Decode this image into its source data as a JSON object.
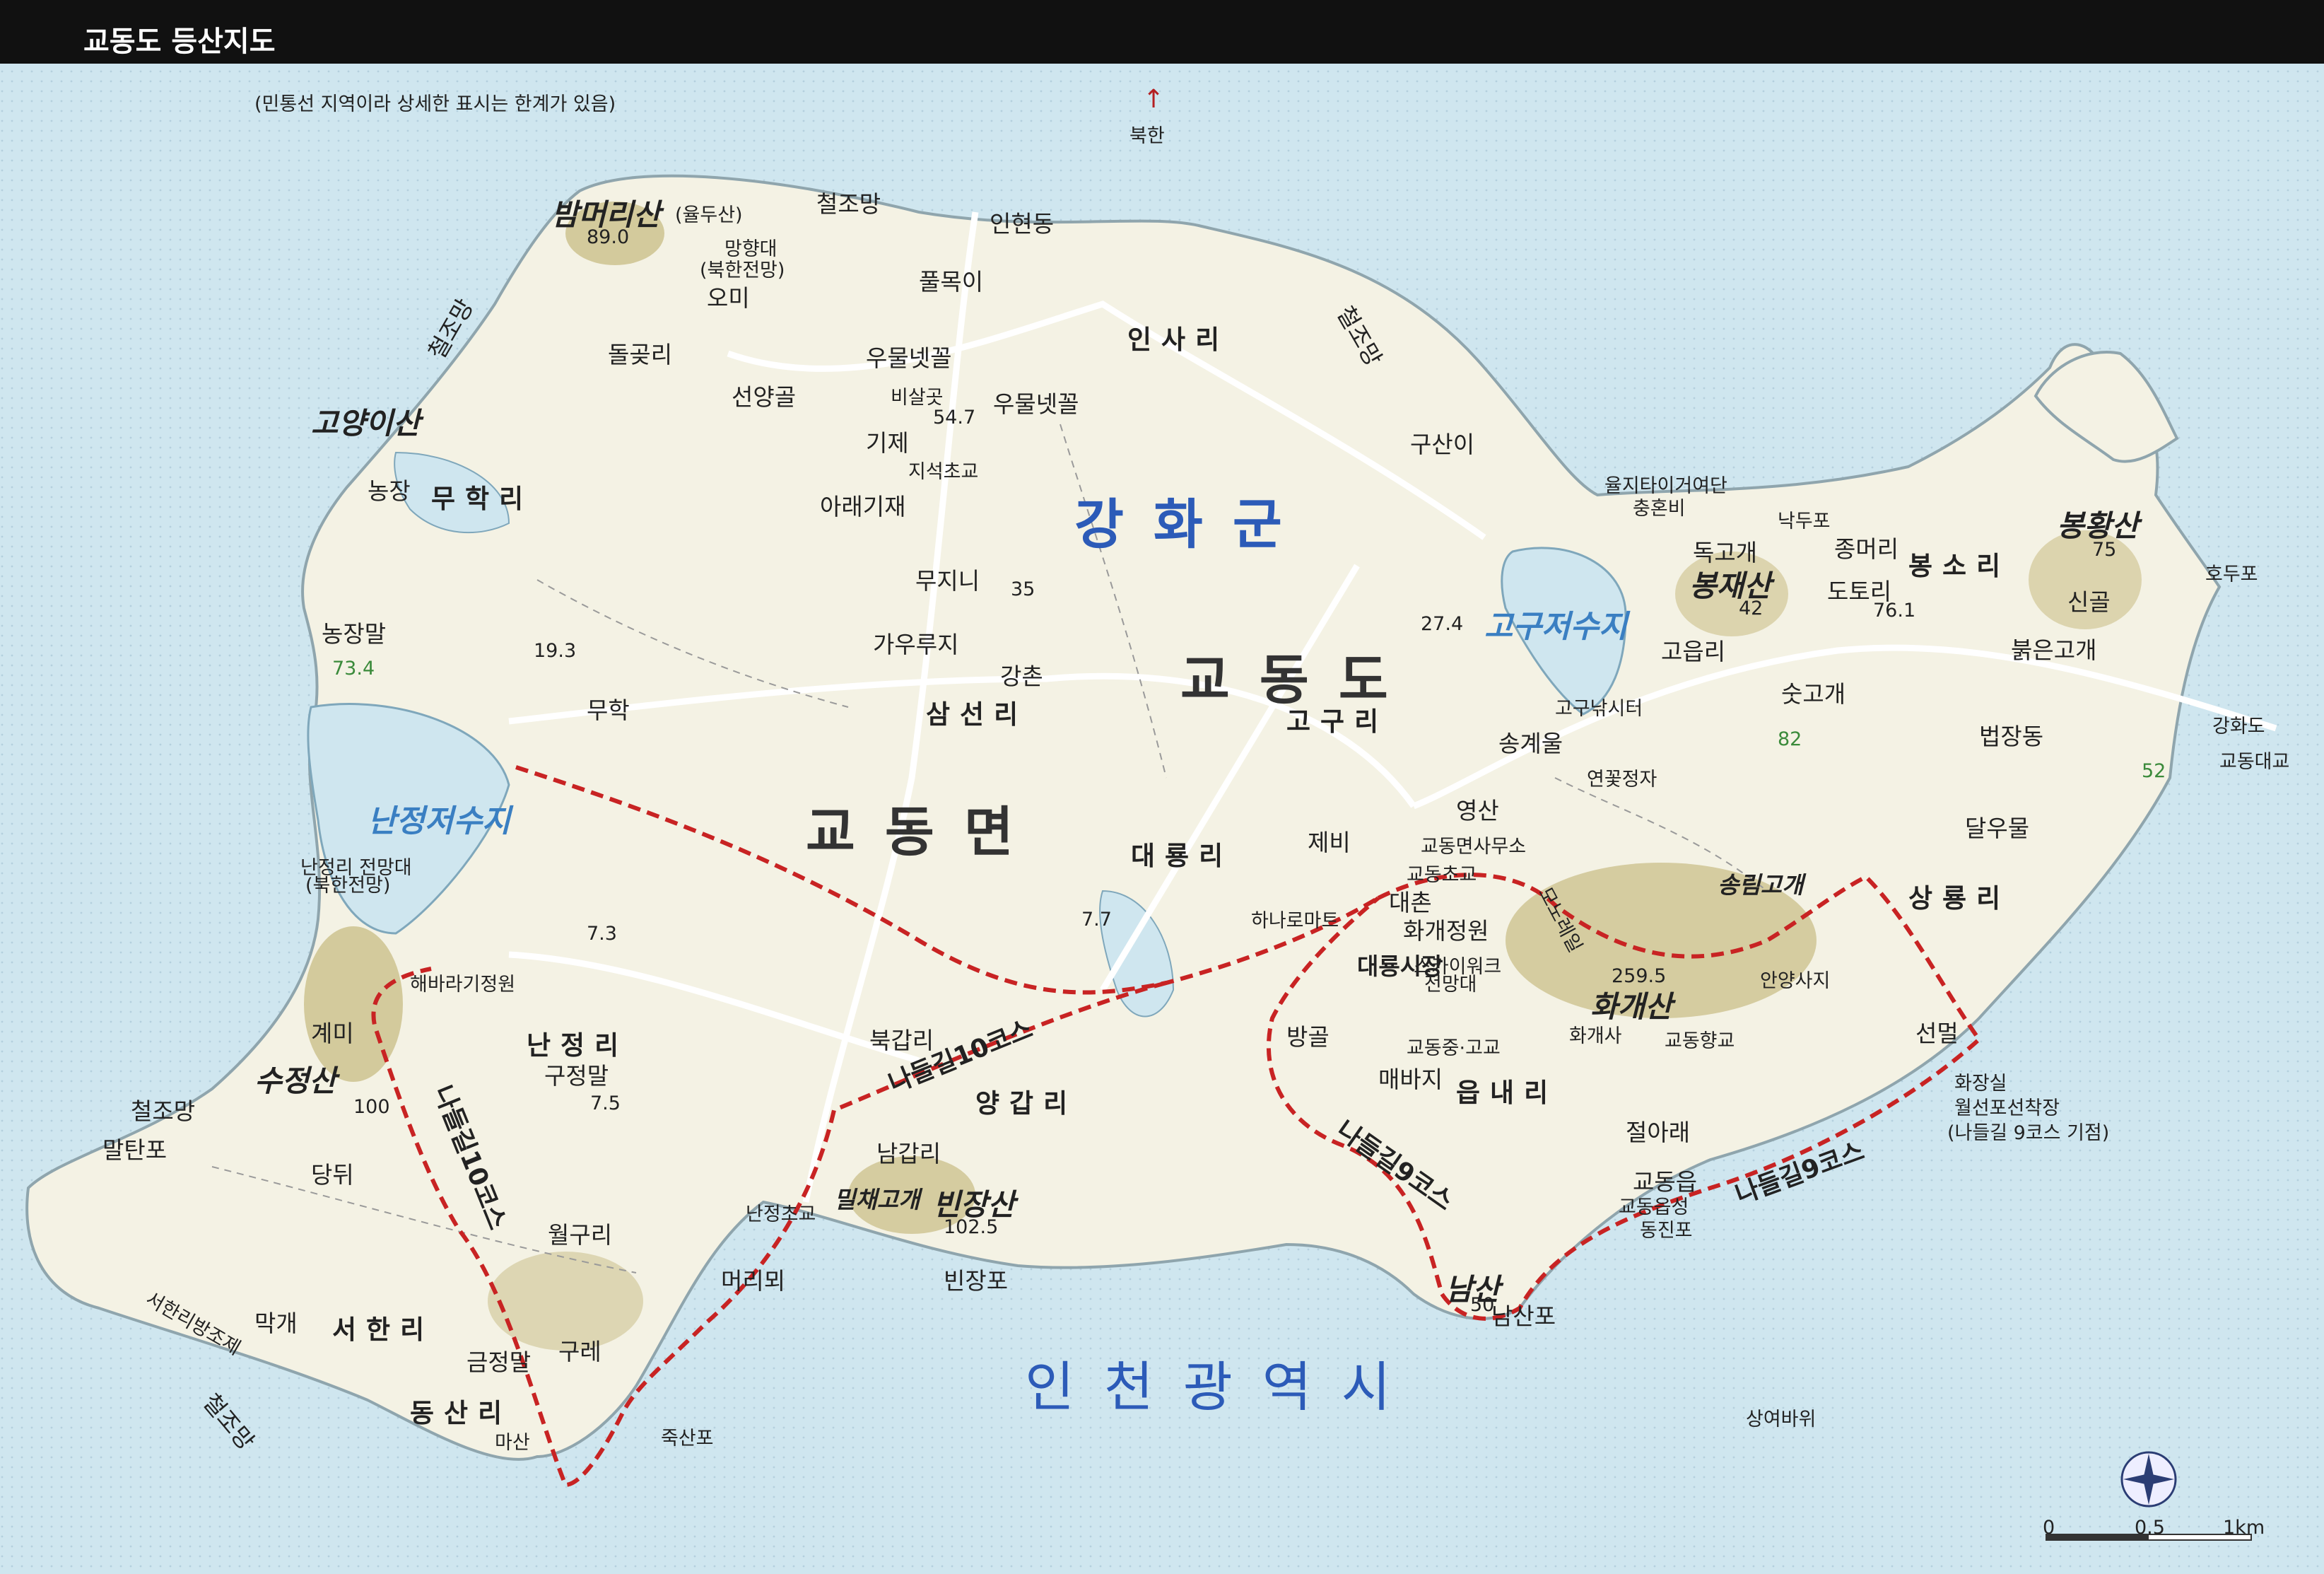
{
  "header": {
    "title": "교동도 등산지도"
  },
  "map": {
    "note": "(민통선 지역이라 상세한 표시는 한계가 있음)",
    "north": "북한",
    "regions": {
      "county": "강화군",
      "island": "교동도",
      "township": "교동면",
      "metro": "인천광역시"
    },
    "villages": [
      "인사리",
      "무학리",
      "삼선리",
      "고구리",
      "대룡리",
      "난정리",
      "양갑리",
      "서한리",
      "동산리",
      "읍내리",
      "봉소리",
      "상룡리"
    ],
    "mountains": {
      "bammeori": "밤머리산",
      "bammeori_alt": "(율두산)",
      "bammeori_h": "89.0",
      "goyangi": "고양이산",
      "sujeong": "수정산",
      "sujeong_h": "100",
      "binjang": "빈장산",
      "binjang_h": "102.5",
      "hwagae": "화개산",
      "hwagae_h": "259.5",
      "bongjae": "봉재산",
      "bongjae_h": "42",
      "bonghwang": "봉황산",
      "bonghwang_h": "75",
      "nam": "남산",
      "nam_h": "50"
    },
    "reservoirs": {
      "nanjeong": "난정저수지",
      "gogu": "고구저수지"
    },
    "trails": {
      "c10a": "나들길10코스",
      "c10b": "나들길10코스",
      "c9a": "나들길9코스",
      "c9b": "나들길9코스"
    },
    "passes": {
      "milchae": "밀채고개",
      "songrim": "송림고개"
    },
    "places": {
      "cheoljomang_top": "철조망",
      "indong": "인현동",
      "manghyang": "망향대",
      "manghyang_sub": "(북한전망)",
      "omi": "오미",
      "pulmok": "풀목이",
      "cheoljomang_left": "철조망",
      "cheoljomang_right": "철조망",
      "dolgot": "돌곶리",
      "umul1": "우물넷꼴",
      "umul2": "우물넷꼴",
      "bisal": "비살곳",
      "bisal_h": "54.7",
      "seonyang": "선양골",
      "gije": "기제",
      "jiseok": "지석초교",
      "araegije": "아래기재",
      "nongjang": "농장",
      "mujini": "무지니",
      "x35": "35",
      "nongjangmal": "농장말",
      "x73": "73.4",
      "h19": "19.3",
      "muhak": "무학",
      "gauru": "가우루지",
      "gangchon": "강촌",
      "gusani": "구산이",
      "h274": "27.4",
      "yulji": "율지타이거여단",
      "chunhon": "충혼비",
      "nakdupo": "낙두포",
      "dokgogae": "독고개",
      "jongmeori": "종머리",
      "dotori": "도토리",
      "h761": "76.1",
      "sin": "신골",
      "hodupo": "호두포",
      "goeup": "고읍리",
      "bakeun": "붉은고개",
      "gogunak": "고구낚시터",
      "sutgogae": "숫고개",
      "x82": "82",
      "songgye": "송계울",
      "yeonkkot": "연꽃정자",
      "beopjang": "법장동",
      "ganghwado": "강화도",
      "gyodongbridge": "교동대교",
      "x52": "52",
      "yeongsan": "영산",
      "myeonoffice": "교동면사무소",
      "jebi": "제비",
      "daechon": "대촌",
      "gyodongcho": "교동초교",
      "dalu": "달우물",
      "nanjeongview": "난정리 전망대",
      "nanjeongview_sub": "(북한전망)",
      "hanaro": "하나로마트",
      "h77": "7.7",
      "hwagaejeongwon": "화개정원",
      "skywalk": "스카이워크",
      "skywalk_sub": "전망대",
      "mojae": "모노레일",
      "daeryongmarket": "대룡시장",
      "angyang": "안양사지",
      "h73": "7.3",
      "haebaragi": "해바라기정원",
      "gyemi": "계미",
      "bukgap": "북갑리",
      "banggol": "방골",
      "hwagaesa": "화개사",
      "gyodonghyang": "교동향교",
      "gyodongmid": "교동중·고교",
      "seonmeol": "선멀",
      "hwajangsil": "화장실",
      "wolseon": "월선포선착장",
      "wolseon_sub": "(나들길 9코스 기점)",
      "gujeong": "구정말",
      "h75": "7.5",
      "maebaji": "매바지",
      "cheolajeol": "절아래",
      "cheoljomang_w": "철조망",
      "maltanpo": "말탄포",
      "dangdwi": "당뒤",
      "namgap": "남갑리",
      "gyodongeup": "교동읍",
      "gyodongeupseong": "교동읍성",
      "dongjinpo": "동진포",
      "wolgu": "월구리",
      "nanjeongcho": "난정초교",
      "meorimoe": "머리뫼",
      "binjangpo": "빈장포",
      "seohandyke": "서한리방조제",
      "makgae": "막개",
      "geumjeong": "금정말",
      "gure": "구레",
      "namsanpo": "남산포",
      "cheoljomang_sw": "철조망",
      "masan": "마산",
      "juksanpo": "죽산포",
      "sangyeo": "상여바위",
      "scale0": "0",
      "scale05": "0.5",
      "scale1": "1km"
    }
  },
  "colors": {
    "sea": "#cfe6ef",
    "land": "#f4f2e4",
    "hill": "#cbbf8a",
    "trail": "#c82323",
    "road": "#ffffff"
  }
}
